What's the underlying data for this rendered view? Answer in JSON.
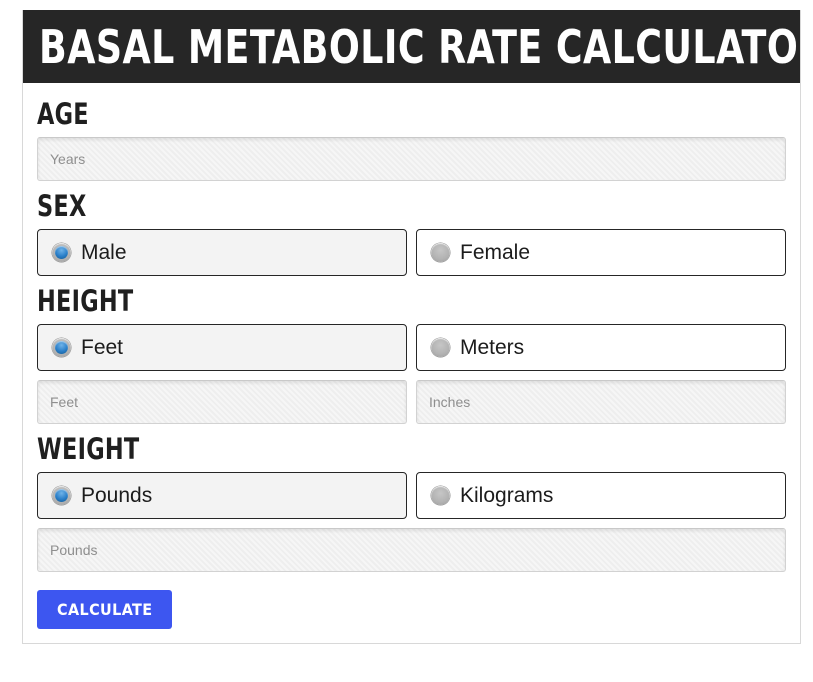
{
  "header": {
    "title": "BASAL METABOLIC RATE CALCULATOR",
    "background_color": "#262626",
    "text_color": "#ffffff"
  },
  "colors": {
    "accent_button": "#3d56f0",
    "radio_selected": "#2a7fc9",
    "radio_unselected": "#b2b2b2",
    "input_background": "#eeeeee",
    "card_border": "#d8d8d8"
  },
  "form": {
    "sections": [
      {
        "label": "AGE",
        "inputs": [
          {
            "name": "age-input",
            "placeholder": "Years",
            "value": ""
          }
        ]
      },
      {
        "label": "SEX",
        "options": [
          {
            "label": "Male",
            "selected": true
          },
          {
            "label": "Female",
            "selected": false
          }
        ]
      },
      {
        "label": "HEIGHT",
        "options": [
          {
            "label": "Feet",
            "selected": true
          },
          {
            "label": "Meters",
            "selected": false
          }
        ],
        "inputs": [
          {
            "name": "height-feet-input",
            "placeholder": "Feet",
            "value": ""
          },
          {
            "name": "height-inches-input",
            "placeholder": "Inches",
            "value": ""
          }
        ]
      },
      {
        "label": "WEIGHT",
        "options": [
          {
            "label": "Pounds",
            "selected": true
          },
          {
            "label": "Kilograms",
            "selected": false
          }
        ],
        "inputs": [
          {
            "name": "weight-input",
            "placeholder": "Pounds",
            "value": ""
          }
        ]
      }
    ],
    "submit_label": "CALCULATE"
  }
}
